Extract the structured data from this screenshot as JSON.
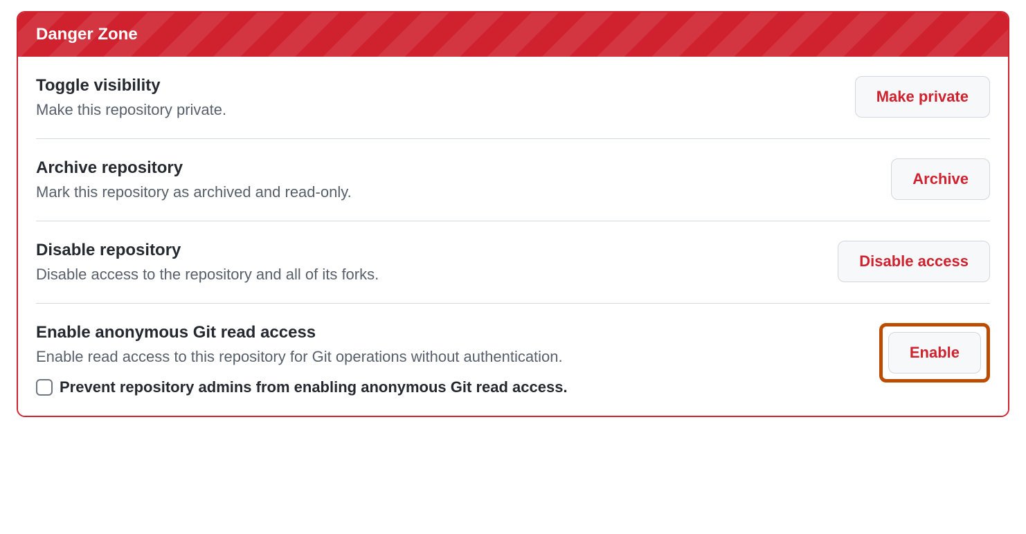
{
  "header": {
    "title": "Danger Zone"
  },
  "items": [
    {
      "title": "Toggle visibility",
      "desc": "Make this repository private.",
      "button": "Make private"
    },
    {
      "title": "Archive repository",
      "desc": "Mark this repository as archived and read-only.",
      "button": "Archive"
    },
    {
      "title": "Disable repository",
      "desc": "Disable access to the repository and all of its forks.",
      "button": "Disable access"
    },
    {
      "title": "Enable anonymous Git read access",
      "desc": "Enable read access to this repository for Git operations without authentication.",
      "button": "Enable",
      "checkbox_label": "Prevent repository admins from enabling anonymous Git read access."
    }
  ]
}
